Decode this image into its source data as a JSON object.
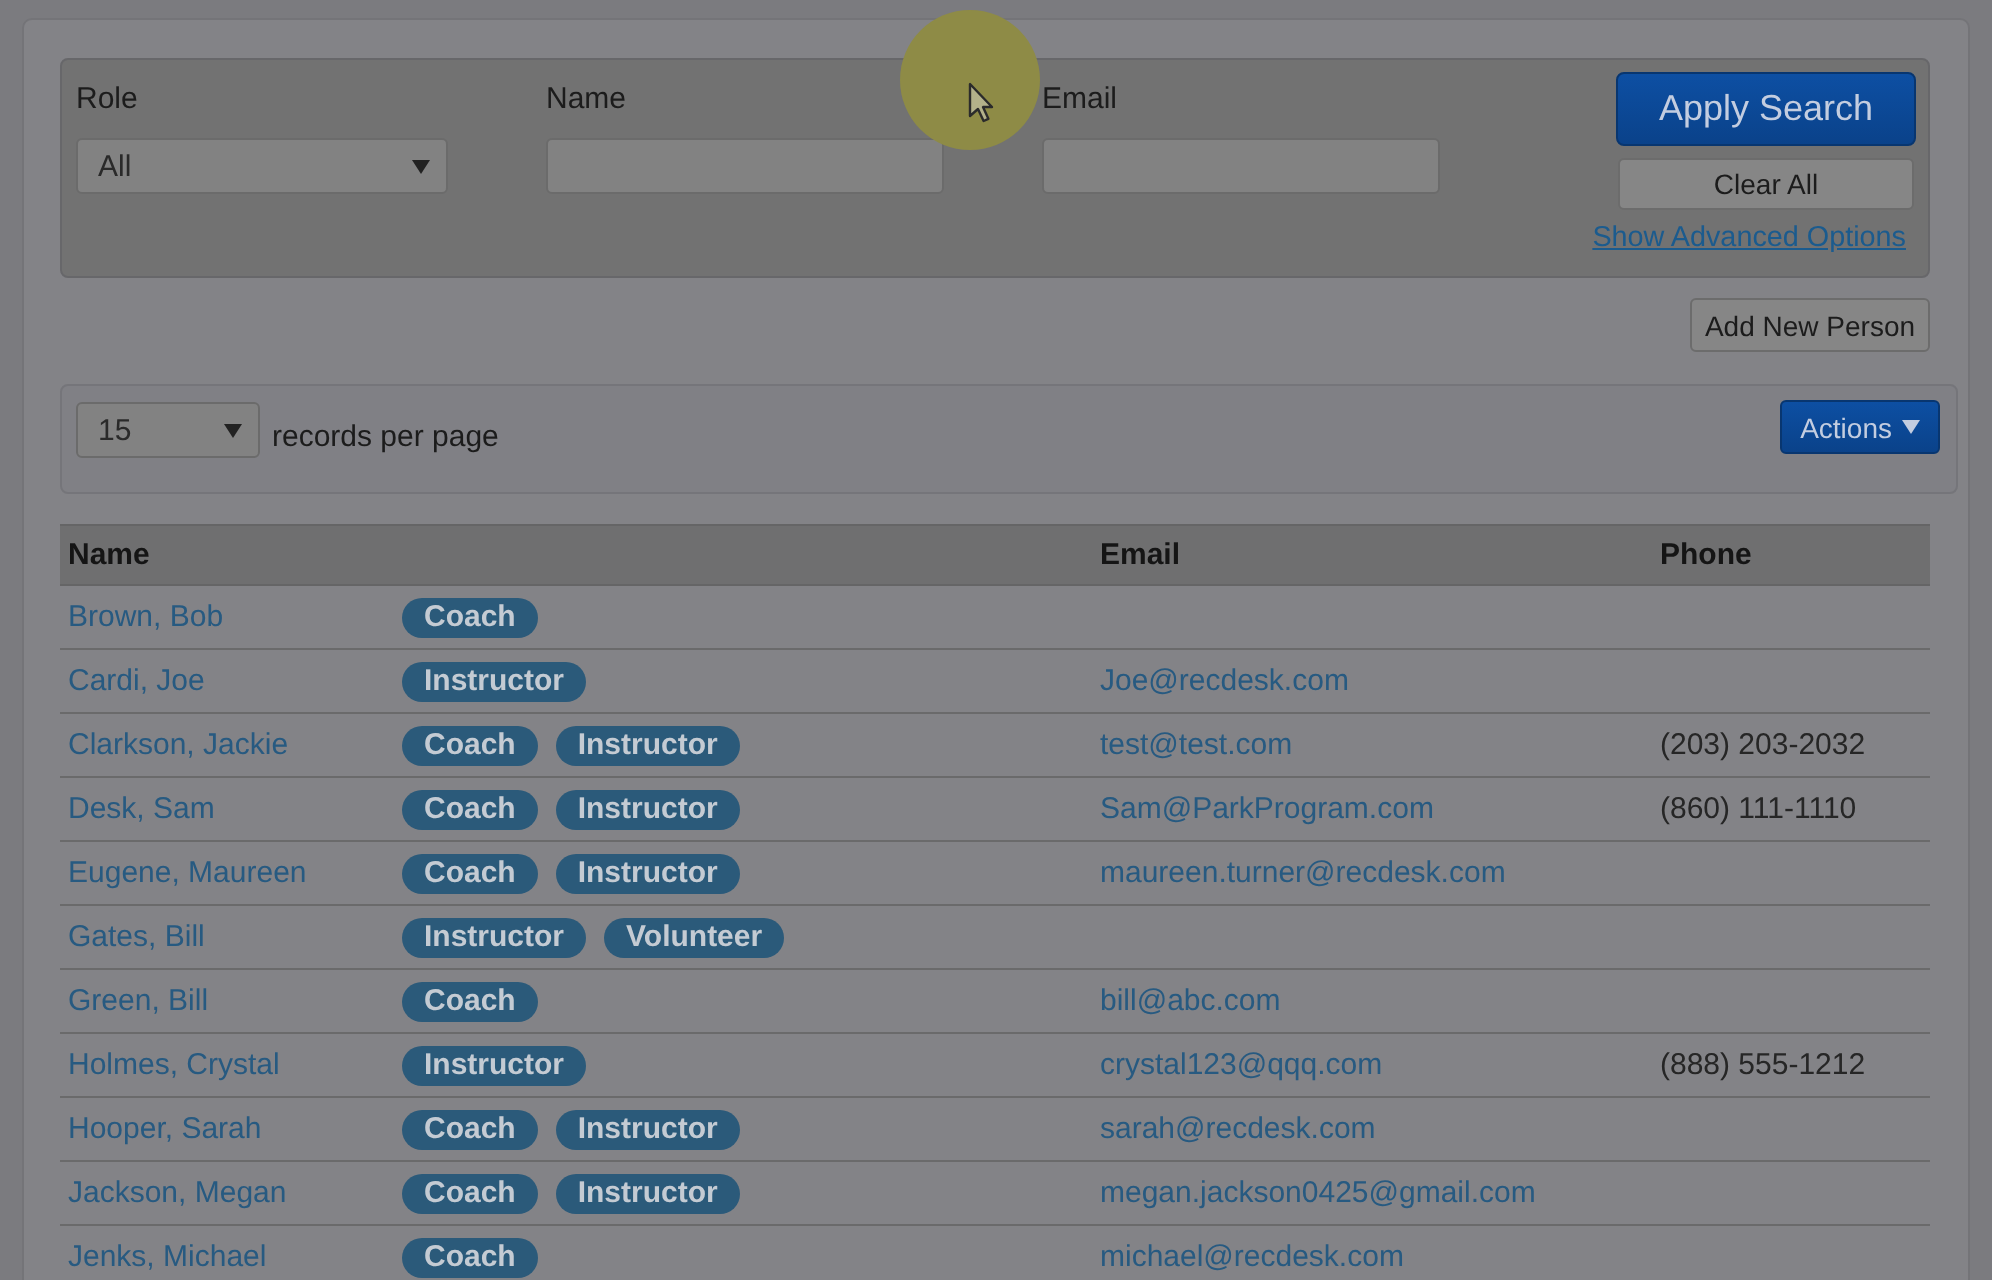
{
  "search_panel": {
    "fields": [
      {
        "kind": "select",
        "label": "Role",
        "value": "All"
      },
      {
        "kind": "text",
        "label": "Name"
      },
      {
        "kind": "text",
        "label": "Email"
      }
    ],
    "apply_button": "Apply Search",
    "clear_button": "Clear All",
    "advanced_link": "Show Advanced Options"
  },
  "add_button": "Add New Person",
  "records_bar": {
    "page_size": "15",
    "page_size_label": "records per page",
    "actions_button": "Actions"
  },
  "table": {
    "columns": [
      "Name",
      "Email",
      "Phone"
    ],
    "rows": [
      {
        "name": "Brown, Bob",
        "roles": [
          "Coach"
        ]
      },
      {
        "name": "Cardi, Joe",
        "roles": [
          "Instructor"
        ],
        "email": "Joe@recdesk.com"
      },
      {
        "name": "Clarkson, Jackie",
        "roles": [
          "Coach",
          "Instructor"
        ],
        "email": "test@test.com",
        "phone": "(203) 203-2032"
      },
      {
        "name": "Desk, Sam",
        "roles": [
          "Coach",
          "Instructor"
        ],
        "email": "Sam@ParkProgram.com",
        "phone": "(860) 111-1110"
      },
      {
        "name": "Eugene, Maureen",
        "roles": [
          "Coach",
          "Instructor"
        ],
        "email": "maureen.turner@recdesk.com"
      },
      {
        "name": "Gates, Bill",
        "roles": [
          "Instructor",
          "Volunteer"
        ]
      },
      {
        "name": "Green, Bill",
        "roles": [
          "Coach"
        ],
        "email": "bill@abc.com"
      },
      {
        "name": "Holmes, Crystal",
        "roles": [
          "Instructor"
        ],
        "email": "crystal123@qqq.com",
        "phone": "(888) 555-1212"
      },
      {
        "name": "Hooper, Sarah",
        "roles": [
          "Coach",
          "Instructor"
        ],
        "email": "sarah@recdesk.com"
      },
      {
        "name": "Jackson, Megan",
        "roles": [
          "Coach",
          "Instructor"
        ],
        "email": "megan.jackson0425@gmail.com"
      },
      {
        "name": "Jenks, Michael",
        "roles": [
          "Coach"
        ],
        "email": "michael@recdesk.com"
      }
    ]
  }
}
